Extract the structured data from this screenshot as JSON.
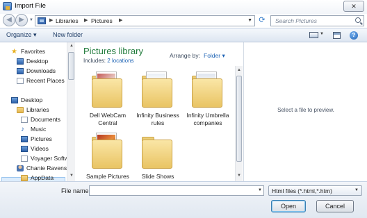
{
  "window": {
    "title": "Import File",
    "close_label": "✕"
  },
  "navigation": {
    "breadcrumb": [
      "Libraries",
      "Pictures"
    ],
    "search_placeholder": "Search Pictures"
  },
  "toolbar": {
    "organize_label": "Organize ▾",
    "new_folder_label": "New folder"
  },
  "nav_pane": {
    "items": [
      {
        "label": "Favorites",
        "icon": "star-icon"
      },
      {
        "label": "Desktop",
        "icon": "desktop-icon"
      },
      {
        "label": "Downloads",
        "icon": "downloads-icon"
      },
      {
        "label": "Recent Places",
        "icon": "recent-places-icon"
      },
      {
        "label": "Desktop",
        "icon": "desktop-icon"
      },
      {
        "label": "Libraries",
        "icon": "libraries-icon"
      },
      {
        "label": "Documents",
        "icon": "documents-icon"
      },
      {
        "label": "Music",
        "icon": "music-icon"
      },
      {
        "label": "Pictures",
        "icon": "pictures-icon",
        "selected": true
      },
      {
        "label": "Videos",
        "icon": "videos-icon"
      },
      {
        "label": "Voyager Softwa",
        "icon": "voyager-folder-icon"
      },
      {
        "label": "Chanie Ravensch",
        "icon": "user-icon"
      },
      {
        "label": "AppData",
        "icon": "folder-icon"
      }
    ]
  },
  "library": {
    "title": "Pictures library",
    "includes_label": "Includes:",
    "includes_link": "2 locations",
    "arrange_label": "Arrange by:",
    "arrange_value": "Folder ▾"
  },
  "folders": [
    {
      "name": "Dell WebCam Central"
    },
    {
      "name": "Infinity Business rules"
    },
    {
      "name": "Infinity Umbrella companies"
    },
    {
      "name": "Sample Pictures"
    },
    {
      "name": "Slide Shows"
    }
  ],
  "preview": {
    "message": "Select a file to preview."
  },
  "bottom": {
    "filename_label": "File name:",
    "filename_value": "",
    "filter_value": "Html files (*.html,*.htm)",
    "open_label": "Open",
    "cancel_label": "Cancel"
  }
}
